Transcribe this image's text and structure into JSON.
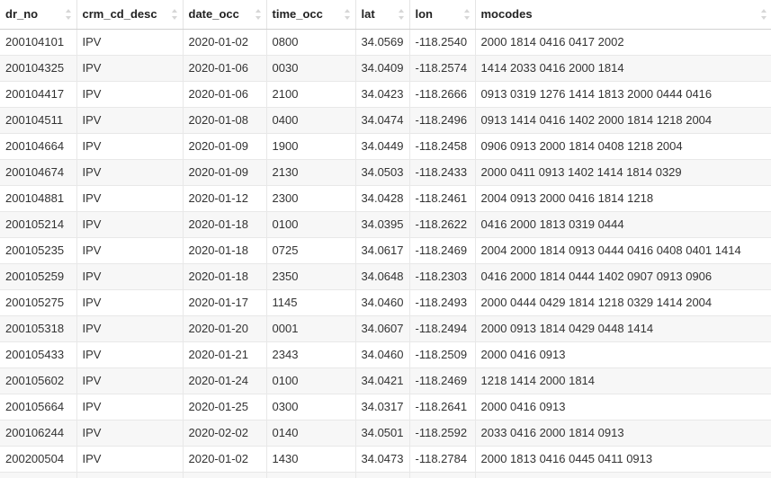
{
  "table": {
    "columns": [
      "dr_no",
      "crm_cd_desc",
      "date_occ",
      "time_occ",
      "lat",
      "lon",
      "mocodes"
    ],
    "sort_icon": "sort-arrows-icon",
    "rows": [
      [
        "200104101",
        "IPV",
        "2020-01-02",
        "0800",
        "34.0569",
        "-118.2540",
        "2000 1814 0416 0417 2002"
      ],
      [
        "200104325",
        "IPV",
        "2020-01-06",
        "0030",
        "34.0409",
        "-118.2574",
        "1414 2033 0416 2000 1814"
      ],
      [
        "200104417",
        "IPV",
        "2020-01-06",
        "2100",
        "34.0423",
        "-118.2666",
        "0913 0319 1276 1414 1813 2000 0444 0416"
      ],
      [
        "200104511",
        "IPV",
        "2020-01-08",
        "0400",
        "34.0474",
        "-118.2496",
        "0913 1414 0416 1402 2000 1814 1218 2004"
      ],
      [
        "200104664",
        "IPV",
        "2020-01-09",
        "1900",
        "34.0449",
        "-118.2458",
        "0906 0913 2000 1814 0408 1218 2004"
      ],
      [
        "200104674",
        "IPV",
        "2020-01-09",
        "2130",
        "34.0503",
        "-118.2433",
        "2000 0411 0913 1402 1414 1814 0329"
      ],
      [
        "200104881",
        "IPV",
        "2020-01-12",
        "2300",
        "34.0428",
        "-118.2461",
        "2004 0913 2000 0416 1814 1218"
      ],
      [
        "200105214",
        "IPV",
        "2020-01-18",
        "0100",
        "34.0395",
        "-118.2622",
        "0416 2000 1813 0319 0444"
      ],
      [
        "200105235",
        "IPV",
        "2020-01-18",
        "0725",
        "34.0617",
        "-118.2469",
        "2004 2000 1814 0913 0444 0416 0408 0401 1414"
      ],
      [
        "200105259",
        "IPV",
        "2020-01-18",
        "2350",
        "34.0648",
        "-118.2303",
        "0416 2000 1814 0444 1402 0907 0913 0906"
      ],
      [
        "200105275",
        "IPV",
        "2020-01-17",
        "1145",
        "34.0460",
        "-118.2493",
        "2000 0444 0429 1814 1218 0329 1414 2004"
      ],
      [
        "200105318",
        "IPV",
        "2020-01-20",
        "0001",
        "34.0607",
        "-118.2494",
        "2000 0913 1814 0429 0448 1414"
      ],
      [
        "200105433",
        "IPV",
        "2020-01-21",
        "2343",
        "34.0460",
        "-118.2509",
        "2000 0416 0913"
      ],
      [
        "200105602",
        "IPV",
        "2020-01-24",
        "0100",
        "34.0421",
        "-118.2469",
        "1218 1414 2000 1814"
      ],
      [
        "200105664",
        "IPV",
        "2020-01-25",
        "0300",
        "34.0317",
        "-118.2641",
        "2000 0416 0913"
      ],
      [
        "200106244",
        "IPV",
        "2020-02-02",
        "0140",
        "34.0501",
        "-118.2592",
        "2033 0416 2000 1814 0913"
      ],
      [
        "200200504",
        "IPV",
        "2020-01-02",
        "1430",
        "34.0473",
        "-118.2784",
        "2000 1813 0416 0445 0411 0913"
      ],
      [
        "",
        "",
        "",
        "",
        "",
        "",
        ""
      ]
    ]
  }
}
